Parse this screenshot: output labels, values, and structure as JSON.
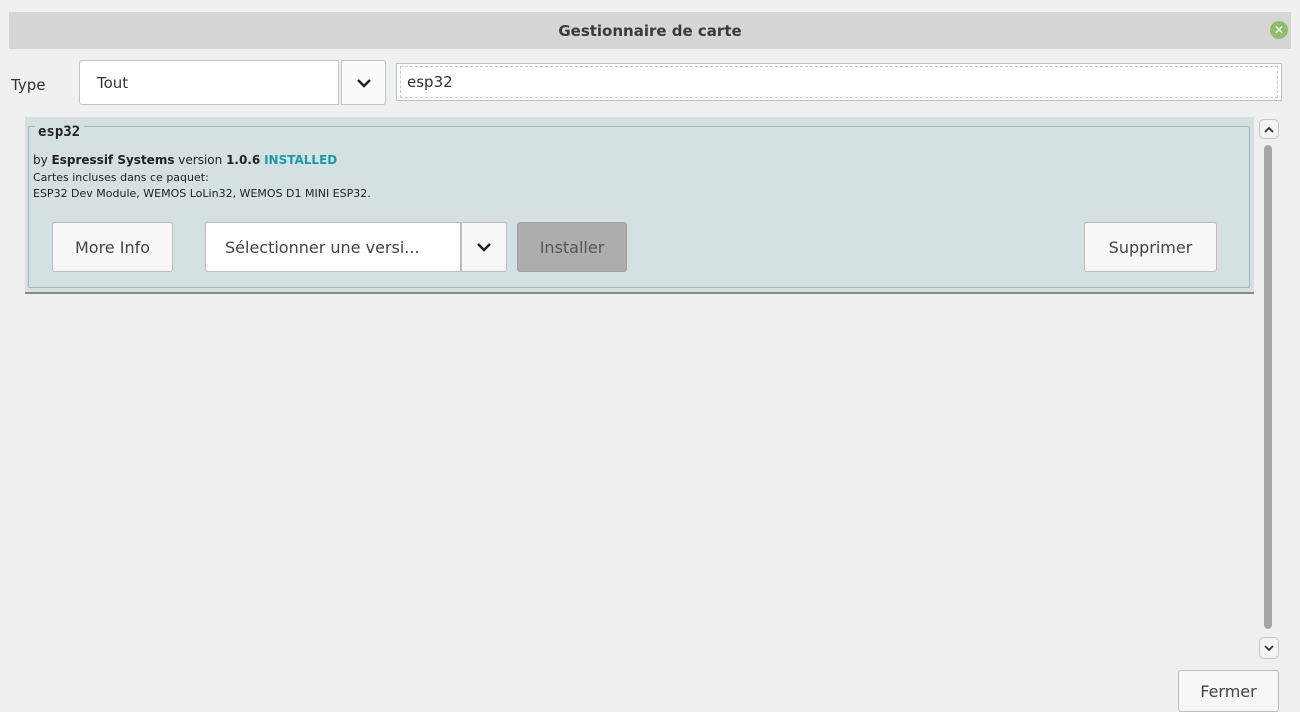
{
  "window": {
    "title": "Gestionnaire de carte"
  },
  "filter": {
    "type_label": "Type",
    "type_value": "Tout",
    "search_value": "esp32"
  },
  "entry": {
    "name": "esp32",
    "by": "by",
    "author": "Espressif Systems",
    "version_label": "version",
    "version": "1.0.6",
    "status": "INSTALLED",
    "boards_label": "Cartes incluses dans ce paquet:",
    "boards": "ESP32 Dev Module, WEMOS LoLin32, WEMOS D1 MINI ESP32.",
    "more_info": "More Info",
    "select_version": "Sélectionner une versi...",
    "install": "Installer",
    "remove": "Supprimer"
  },
  "footer": {
    "close": "Fermer"
  },
  "colors": {
    "installed": "#1c9aa3",
    "panel": "#d5e0e2",
    "close_icon": "#8ebd6b"
  },
  "icons": {
    "close": "close-icon",
    "dropdown": "chevron-down-icon",
    "scroll_up": "chevron-up-icon",
    "scroll_down": "chevron-down-icon"
  }
}
